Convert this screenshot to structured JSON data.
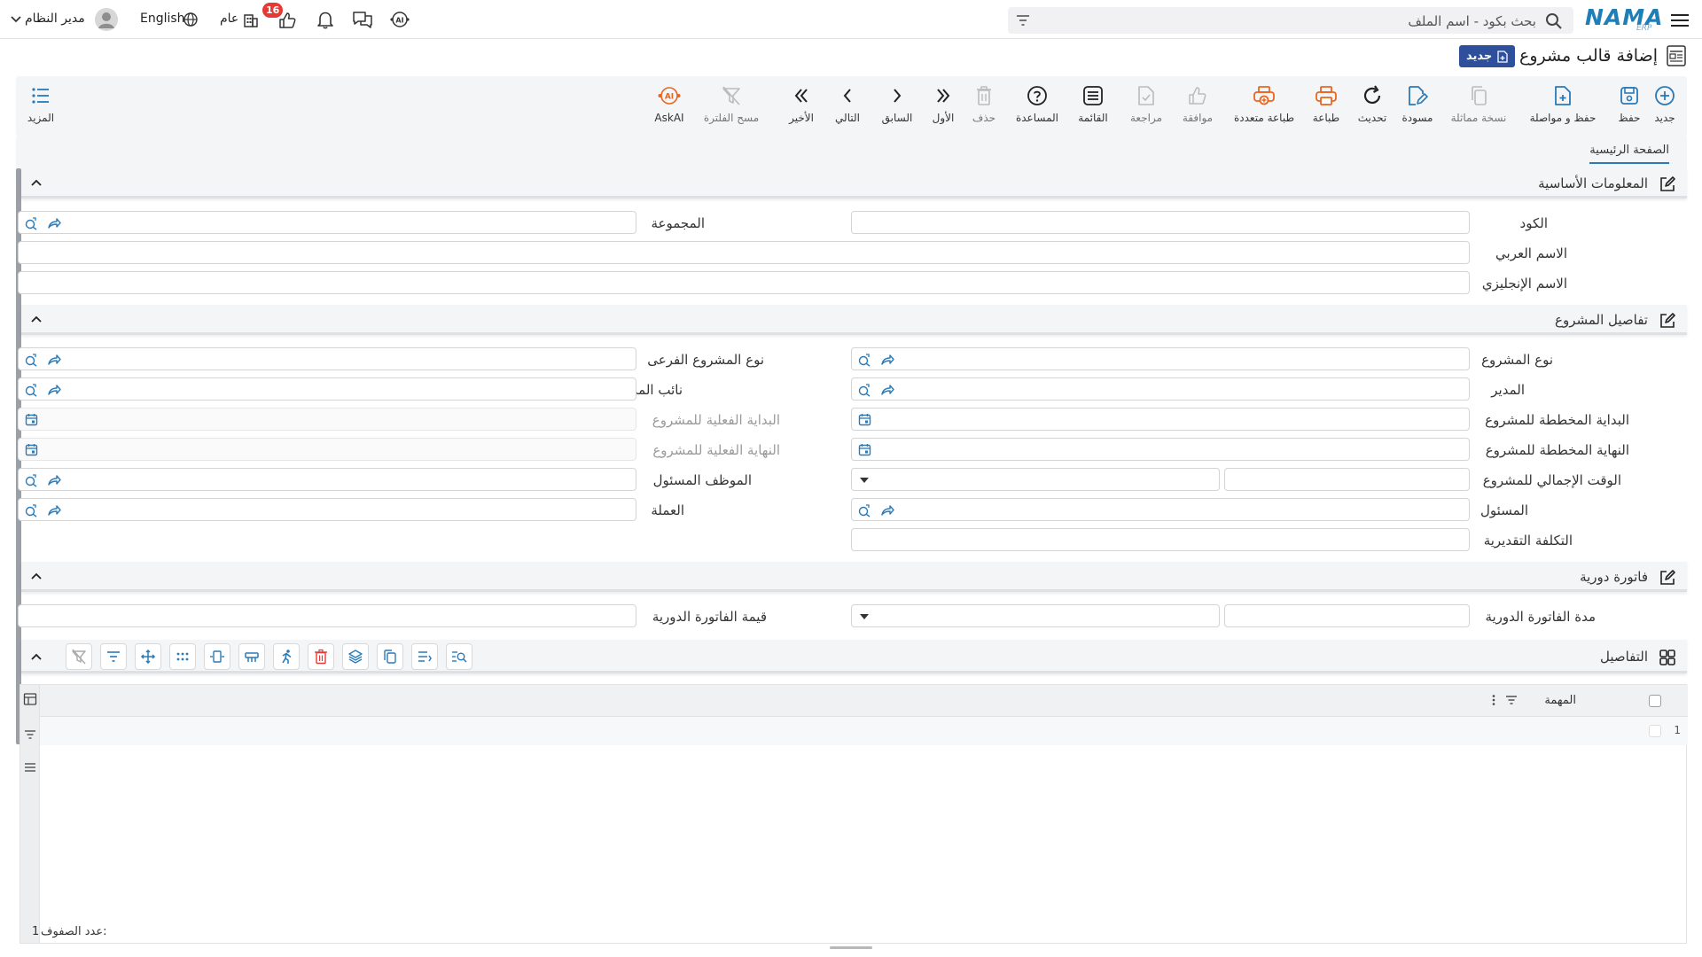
{
  "header": {
    "brand": "NAMA",
    "brand_sub": "ERP",
    "search_placeholder": "بحث بكود - اسم الملف",
    "user_name": "مدير النظام",
    "language": "English",
    "scope": "عام",
    "notification_count": "16",
    "icons": [
      "menu-icon",
      "filter-icon",
      "search-icon",
      "user-avatar-icon",
      "chevron-down-icon",
      "globe-icon",
      "building-icon",
      "thumbs-up-icon",
      "bell-icon",
      "chat-icon",
      "ai-assistant-icon"
    ]
  },
  "page": {
    "title": "إضافة قالب مشروع",
    "new_tag": "جديد"
  },
  "toolbar": {
    "new": "جديد",
    "save": "حفظ",
    "save_continue": "حفظ و مواصلة",
    "duplicate": "نسخة مماثلة",
    "draft": "مسودة",
    "refresh": "تحديث",
    "print": "طباعة",
    "multi_print": "طباعة متعددة",
    "approve": "موافقة",
    "review": "مراجعة",
    "list": "القائمة",
    "help": "المساعدة",
    "delete": "حذف",
    "first": "الأول",
    "previous": "السابق",
    "next": "التالي",
    "last": "الأخير",
    "clear_filter": "مسح الفلترة",
    "askai": "AskAI",
    "more": "المزيد"
  },
  "tabs": {
    "main": "الصفحة الرئيسية"
  },
  "sections": {
    "basic": {
      "title": "المعلومات الأساسية",
      "code": "الكود",
      "group": "المجموعة",
      "arabic_name": "الاسم العربي",
      "english_name": "الاسم الإنجليزي"
    },
    "details": {
      "title": "تفاصيل المشروع",
      "project_type": "نوع المشروع",
      "sub_project_type": "نوع المشروع الفرعى",
      "manager": "المدير",
      "deputy_manager": "نائب المدير",
      "planned_start": "البداية المخططة للمشروع",
      "actual_start": "البداية الفعلية للمشروع",
      "planned_end": "النهاية المخططة للمشروع",
      "actual_end": "النهاية الفعلية للمشروع",
      "total_time": "الوقت الإجمالي للمشروع",
      "responsible_employee": "الموظف المسئول",
      "responsible": "المسئول",
      "currency": "العملة",
      "estimated_cost": "التكلفة التقديرية"
    },
    "periodic": {
      "title": "فاتورة دورية",
      "period": "مدة الفاتورة الدورية",
      "value": "قيمة الفاتورة الدورية"
    },
    "grid": {
      "title": "التفاصيل",
      "column_task": "المهمة",
      "row_number": "1",
      "row_count_label": "عدد الصفوف:",
      "row_count": "1"
    }
  },
  "colors": {
    "accent": "#2a7ab8",
    "print_orange": "#e8661f",
    "tag_blue": "#2d4f9c",
    "badge_red": "#e53935"
  }
}
